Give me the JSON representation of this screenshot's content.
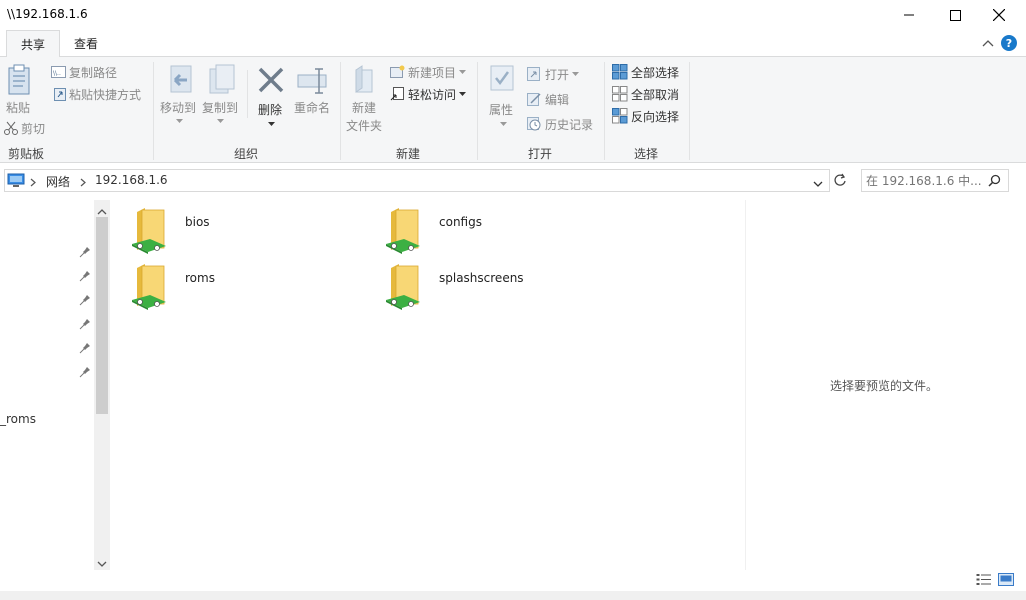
{
  "window": {
    "title": "\\\\192.168.1.6"
  },
  "tabs": [
    {
      "label": "共享"
    },
    {
      "label": "查看"
    }
  ],
  "ribbon": {
    "clipboard": {
      "pin_label": "粘贴",
      "copy_path": "复制路径",
      "paste_shortcut": "粘贴快捷方式",
      "cut": "剪切",
      "group": "剪贴板"
    },
    "organize": {
      "move_to": "移动到",
      "copy_to": "复制到",
      "delete": "删除",
      "rename": "重命名",
      "group": "组织"
    },
    "new": {
      "new_folder_1": "新建",
      "new_folder_2": "文件夹",
      "new_item": "新建项目",
      "easy_access": "轻松访问",
      "group": "新建"
    },
    "open": {
      "properties": "属性",
      "open": "打开",
      "edit": "编辑",
      "history": "历史记录",
      "group": "打开"
    },
    "select": {
      "select_all": "全部选择",
      "select_none": "全部取消",
      "invert": "反向选择",
      "group": "选择"
    }
  },
  "address": {
    "network": "网络",
    "host": "192.168.1.6"
  },
  "search": {
    "placeholder": "在 192.168.1.6 中..."
  },
  "nav": {
    "partial_item": "_roms"
  },
  "items": [
    {
      "name": "bios"
    },
    {
      "name": "configs"
    },
    {
      "name": "roms"
    },
    {
      "name": "splashscreens"
    }
  ],
  "preview": {
    "message": "选择要预览的文件。"
  },
  "colors": {
    "accent": "#1979ca",
    "folder": "#f8d775",
    "share": "#3cb043"
  }
}
